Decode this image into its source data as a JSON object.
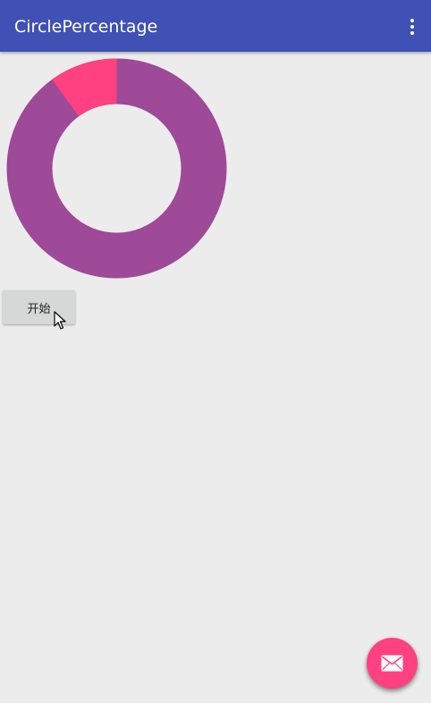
{
  "app_bar": {
    "title": "CirclePercentage",
    "overflow_icon": "more-vert-icon",
    "color": "#3f51b5"
  },
  "donut": {
    "percent_primary": 0.9,
    "percent_secondary": 0.1,
    "primary_color": "#9e4a98",
    "secondary_color": "#ff4081"
  },
  "start_button": {
    "label": "开始"
  },
  "fab": {
    "icon": "email-icon",
    "color": "#ff4081"
  }
}
